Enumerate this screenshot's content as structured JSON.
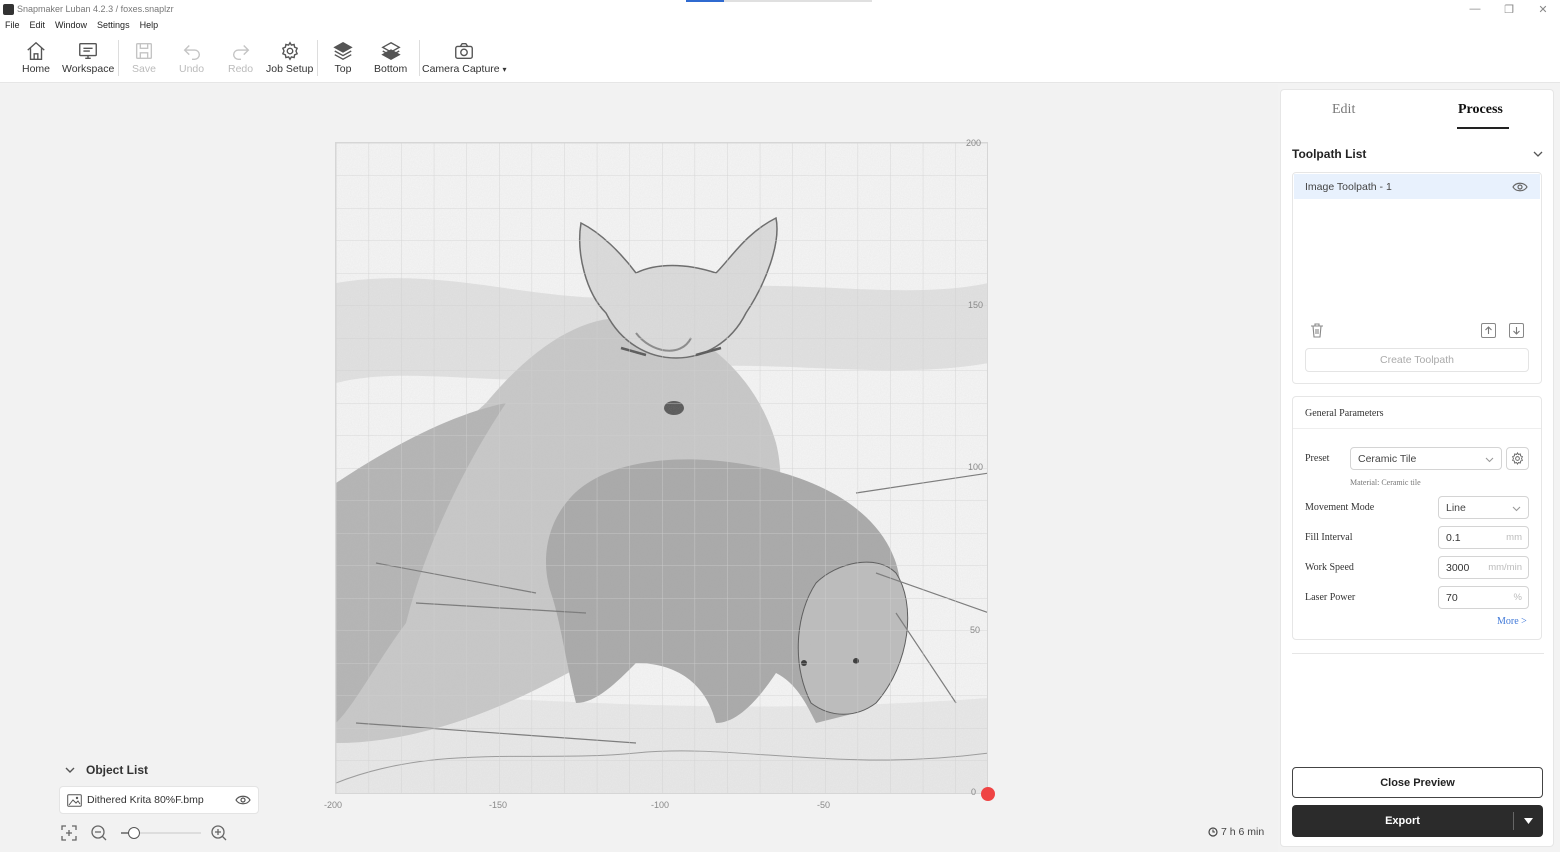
{
  "window": {
    "title": "Snapmaker Luban 4.2.3 / foxes.snaplzr",
    "controls": [
      "minimize-icon",
      "restore-icon",
      "close-icon"
    ]
  },
  "menu": [
    "File",
    "Edit",
    "Window",
    "Settings",
    "Help"
  ],
  "toolbar": {
    "home": "Home",
    "workspace": "Workspace",
    "save": "Save",
    "undo": "Undo",
    "redo": "Redo",
    "job_setup": "Job Setup",
    "top": "Top",
    "bottom": "Bottom",
    "camera_capture": "Camera Capture"
  },
  "canvas": {
    "x_ticks": [
      "-200",
      "-150",
      "-100",
      "-50",
      "0"
    ],
    "y_ticks": [
      "200",
      "150",
      "100",
      "50"
    ],
    "image_description_icon": "fox-engraving-preview"
  },
  "object_list": {
    "title": "Object List",
    "items": [
      {
        "name": "Dithered Krita 80%F.bmp"
      }
    ],
    "zoom_level": 0.1
  },
  "estimated_time": "7 h 6 min",
  "panel": {
    "tabs": {
      "edit": "Edit",
      "process": "Process"
    },
    "active_tab": "Process",
    "toolpath_list": {
      "title": "Toolpath List",
      "items": [
        {
          "name": "Image Toolpath - 1"
        }
      ],
      "create_button": "Create Toolpath"
    },
    "general_parameters": {
      "title": "General Parameters",
      "preset_label": "Preset",
      "preset_value": "Ceramic Tile",
      "material_note": "Material: Ceramic tile",
      "movement_mode_label": "Movement Mode",
      "movement_mode_value": "Line",
      "fill_interval_label": "Fill Interval",
      "fill_interval_value": "0.1",
      "fill_interval_unit": "mm",
      "work_speed_label": "Work Speed",
      "work_speed_value": "3000",
      "work_speed_unit": "mm/min",
      "laser_power_label": "Laser Power",
      "laser_power_value": "70",
      "laser_power_unit": "%",
      "more_link": "More >"
    },
    "close_preview": "Close Preview",
    "export": "Export"
  },
  "colors": {
    "accent_blue": "#2f6ad0",
    "origin_red": "#ef4444",
    "export_dark": "#2b2b2b",
    "selection_bg": "#e8f1fd"
  }
}
